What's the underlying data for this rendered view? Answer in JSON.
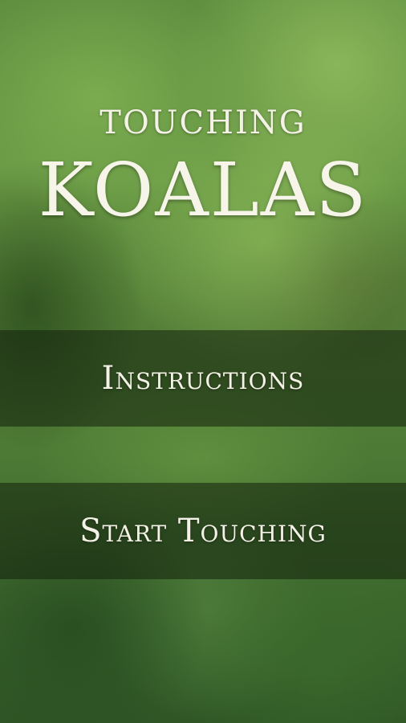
{
  "title": {
    "line1": "TOUCHING",
    "line2": "KOALAS"
  },
  "menu": {
    "instructions_label": "Instructions",
    "start_label": "Start Touching"
  },
  "colors": {
    "text": "#f4f1e6",
    "button_band": "rgba(18,32,12,0.55)",
    "background_green": "#5f8f3f"
  }
}
